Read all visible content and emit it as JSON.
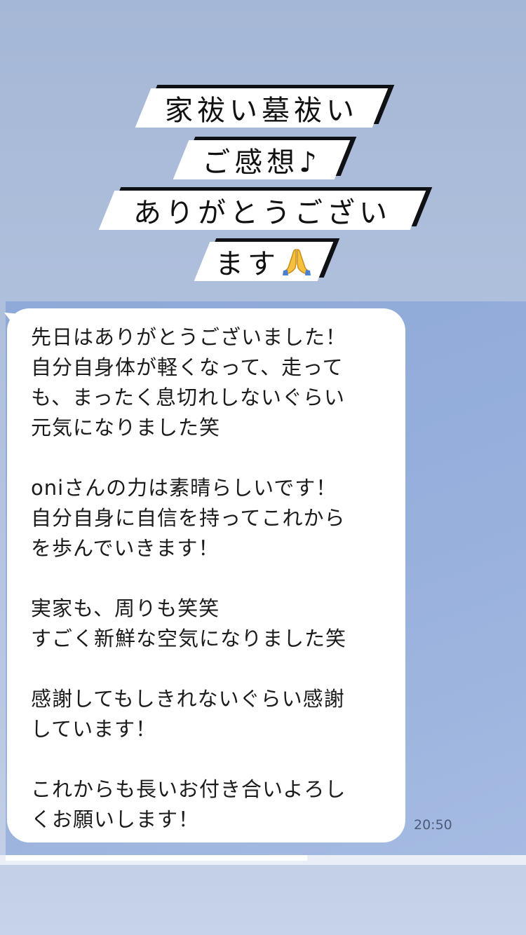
{
  "caption": {
    "lines": [
      "家祓い墓祓い",
      "ご感想♪",
      "ありがとうござい",
      "ます"
    ],
    "trailing_icon": "folded-hands-emoji"
  },
  "message": {
    "paragraphs": [
      [
        "先日はありがとうございました！",
        "自分自身体が軽くなって、走って",
        "も、まったく息切れしないぐらい",
        "元気になりました笑"
      ],
      [
        "oniさんの力は素晴らしいです！",
        "自分自身に自信を持ってこれから",
        "を歩んでいきます！"
      ],
      [
        "実家も、周りも笑笑",
        "すごく新鮮な空気になりました笑"
      ],
      [
        "感謝してもしきれないぐらい感謝",
        "しています！"
      ],
      [
        "これからも長いお付き合いよろし",
        "くお願いします！"
      ]
    ],
    "time": "20:50"
  },
  "colors": {
    "page_top": "#a5b7d6",
    "chat_background": "#95aedb",
    "bubble": "#ffffff",
    "caption_plate": "#ffffff",
    "caption_shadow": "#101114"
  }
}
